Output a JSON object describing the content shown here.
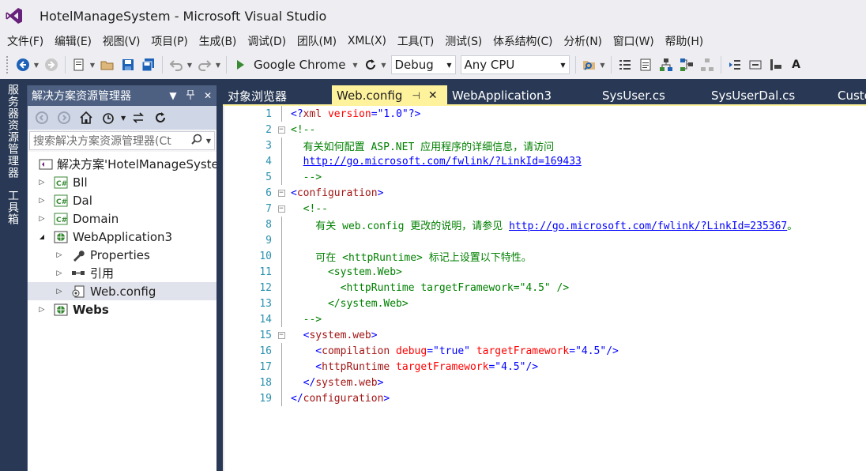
{
  "window": {
    "title": "HotelManageSystem - Microsoft Visual Studio"
  },
  "menu": [
    "文件(F)",
    "编辑(E)",
    "视图(V)",
    "项目(P)",
    "生成(B)",
    "调试(D)",
    "团队(M)",
    "XML(X)",
    "工具(T)",
    "测试(S)",
    "体系结构(C)",
    "分析(N)",
    "窗口(W)",
    "帮助(H)"
  ],
  "toolbar": {
    "run_target": "Google Chrome",
    "configuration": "Debug",
    "platform": "Any CPU"
  },
  "left_tabs": {
    "server_explorer": "服务器资源管理器",
    "toolbox": "工具箱"
  },
  "solution_explorer": {
    "title": "解决方案资源管理器",
    "search_placeholder": "搜索解决方案资源管理器(Ct",
    "solution_label": "解决方案'HotelManageSyste",
    "items": [
      {
        "label": "Bll",
        "level": 1
      },
      {
        "label": "Dal",
        "level": 1
      },
      {
        "label": "Domain",
        "level": 1
      },
      {
        "label": "WebApplication3",
        "level": 1
      },
      {
        "label": "Properties",
        "level": 2
      },
      {
        "label": "引用",
        "level": 2
      },
      {
        "label": "Web.config",
        "level": 2
      },
      {
        "label": "Webs",
        "level": 1
      }
    ]
  },
  "tabs": [
    "对象浏览器",
    "Web.config",
    "WebApplication3",
    "SysUser.cs",
    "SysUserDal.cs",
    "Custo"
  ],
  "code_lines": [
    {
      "n": "1",
      "parts": [
        {
          "t": "<?",
          "c": "c-blue"
        },
        {
          "t": "xml",
          "c": "c-brown"
        },
        {
          "t": " version",
          "c": "c-red"
        },
        {
          "t": "=",
          "c": "c-blue"
        },
        {
          "t": "\"",
          "c": "c-blue"
        },
        {
          "t": "1.0",
          "c": "c-blue"
        },
        {
          "t": "\"",
          "c": "c-blue"
        },
        {
          "t": "?>",
          "c": "c-blue"
        }
      ]
    },
    {
      "n": "2",
      "parts": [
        {
          "t": "<!--",
          "c": "c-green"
        }
      ]
    },
    {
      "n": "3",
      "parts": [
        {
          "t": "  有关如何配置 ASP.NET 应用程序的详细信息，请访问",
          "c": "c-green"
        }
      ]
    },
    {
      "n": "4",
      "parts": [
        {
          "t": "  ",
          "c": "c-green"
        },
        {
          "t": "http://go.microsoft.com/fwlink/?LinkId=169433",
          "c": "c-link"
        }
      ]
    },
    {
      "n": "5",
      "parts": [
        {
          "t": "  -->",
          "c": "c-green"
        }
      ]
    },
    {
      "n": "6",
      "parts": [
        {
          "t": "<",
          "c": "c-blue"
        },
        {
          "t": "configuration",
          "c": "c-brown"
        },
        {
          "t": ">",
          "c": "c-blue"
        }
      ]
    },
    {
      "n": "7",
      "parts": [
        {
          "t": "  <!--",
          "c": "c-green"
        }
      ]
    },
    {
      "n": "8",
      "parts": [
        {
          "t": "    有关 web.config 更改的说明，请参见 ",
          "c": "c-green"
        },
        {
          "t": "http://go.microsoft.com/fwlink/?LinkId=235367",
          "c": "c-link"
        },
        {
          "t": "。",
          "c": "c-green"
        }
      ]
    },
    {
      "n": "9",
      "parts": []
    },
    {
      "n": "10",
      "parts": [
        {
          "t": "    可在 <httpRuntime> 标记上设置以下特性。",
          "c": "c-green"
        }
      ]
    },
    {
      "n": "11",
      "parts": [
        {
          "t": "      <system.Web>",
          "c": "c-green"
        }
      ]
    },
    {
      "n": "12",
      "parts": [
        {
          "t": "        <httpRuntime targetFramework=\"4.5\" />",
          "c": "c-green"
        }
      ]
    },
    {
      "n": "13",
      "parts": [
        {
          "t": "      </system.Web>",
          "c": "c-green"
        }
      ]
    },
    {
      "n": "14",
      "parts": [
        {
          "t": "  -->",
          "c": "c-green"
        }
      ]
    },
    {
      "n": "15",
      "parts": [
        {
          "t": "  <",
          "c": "c-blue"
        },
        {
          "t": "system.web",
          "c": "c-brown"
        },
        {
          "t": ">",
          "c": "c-blue"
        }
      ]
    },
    {
      "n": "16",
      "parts": [
        {
          "t": "    <",
          "c": "c-blue"
        },
        {
          "t": "compilation",
          "c": "c-brown"
        },
        {
          "t": " debug",
          "c": "c-red"
        },
        {
          "t": "=",
          "c": "c-blue"
        },
        {
          "t": "\"",
          "c": "c-blue"
        },
        {
          "t": "true",
          "c": "c-blue"
        },
        {
          "t": "\"",
          "c": "c-blue"
        },
        {
          "t": " targetFramework",
          "c": "c-red"
        },
        {
          "t": "=",
          "c": "c-blue"
        },
        {
          "t": "\"",
          "c": "c-blue"
        },
        {
          "t": "4.5",
          "c": "c-blue"
        },
        {
          "t": "\"",
          "c": "c-blue"
        },
        {
          "t": "/>",
          "c": "c-blue"
        }
      ]
    },
    {
      "n": "17",
      "parts": [
        {
          "t": "    <",
          "c": "c-blue"
        },
        {
          "t": "httpRuntime",
          "c": "c-brown"
        },
        {
          "t": " targetFramework",
          "c": "c-red"
        },
        {
          "t": "=",
          "c": "c-blue"
        },
        {
          "t": "\"",
          "c": "c-blue"
        },
        {
          "t": "4.5",
          "c": "c-blue"
        },
        {
          "t": "\"",
          "c": "c-blue"
        },
        {
          "t": "/>",
          "c": "c-blue"
        }
      ]
    },
    {
      "n": "18",
      "parts": [
        {
          "t": "  </",
          "c": "c-blue"
        },
        {
          "t": "system.web",
          "c": "c-brown"
        },
        {
          "t": ">",
          "c": "c-blue"
        }
      ]
    },
    {
      "n": "19",
      "parts": [
        {
          "t": "</",
          "c": "c-blue"
        },
        {
          "t": "configuration",
          "c": "c-brown"
        },
        {
          "t": ">",
          "c": "c-blue"
        }
      ]
    }
  ]
}
